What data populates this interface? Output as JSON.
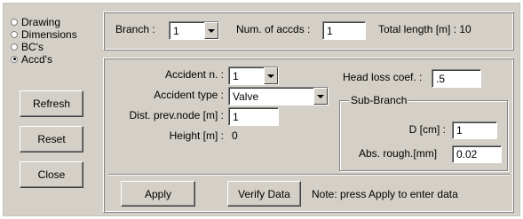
{
  "nav": {
    "options": [
      {
        "label": "Drawing",
        "checked": false
      },
      {
        "label": "Dimensions",
        "checked": false
      },
      {
        "label": "BC's",
        "checked": false
      },
      {
        "label": "Accd's",
        "checked": true
      }
    ],
    "refresh_label": "Refresh",
    "reset_label": "Reset",
    "close_label": "Close"
  },
  "top": {
    "branch_label": "Branch :",
    "branch_value": "1",
    "num_accds_label": "Num. of accds :",
    "num_accds_value": "1",
    "total_length_label": "Total length [m] : 10"
  },
  "accident": {
    "accident_n_label": "Accident n. :",
    "accident_n_value": "1",
    "accident_type_label": "Accident type :",
    "accident_type_value": "Valve",
    "dist_label": "Dist. prev.node [m] :",
    "dist_value": "1",
    "height_label": "Height [m] :",
    "height_value": "0",
    "head_loss_label": "Head loss coef. :",
    "head_loss_value": ".5"
  },
  "sub_branch": {
    "title": "Sub-Branch",
    "d_label": "D [cm] :",
    "d_value": "1",
    "abs_rough_label": "Abs. rough.[mm]",
    "abs_rough_value": "0.02"
  },
  "actions": {
    "apply_label": "Apply",
    "verify_label": "Verify Data",
    "note": "Note: press Apply to enter data"
  }
}
